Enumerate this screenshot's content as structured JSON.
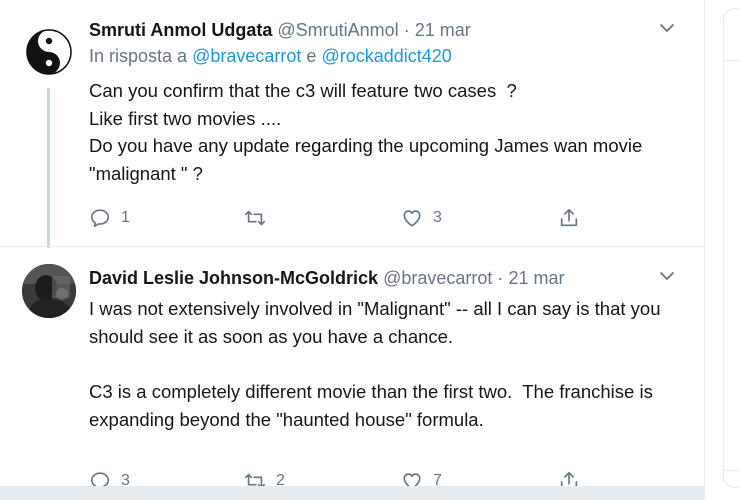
{
  "tweets": [
    {
      "display_name": "Smruti Anmol Udgata",
      "handle": "@SmrutiAnmol",
      "separator": "·",
      "date": "21 mar",
      "reply_prefix": "In risposta a",
      "reply_user1": "@bravecarrot",
      "reply_conj": "e",
      "reply_user2": "@rockaddict420",
      "text": "Can you confirm that the c3 will feature two cases  ?\nLike first two movies ....\nDo you have any update regarding the upcoming James wan movie \"malignant \" ?",
      "reply_count": "1",
      "retweet_count": "",
      "like_count": "3",
      "avatar_icon": "yin-yang-icon"
    },
    {
      "display_name": "David Leslie Johnson-McGoldrick",
      "handle": "@bravecarrot",
      "separator": "·",
      "date": "21 mar",
      "text": "I was not extensively involved in \"Malignant\" -- all I can say is that you should see it as soon as you have a chance.\n\nC3 is a completely different movie than the first two.  The franchise is expanding beyond the \"haunted house\" formula.",
      "reply_count": "3",
      "retweet_count": "2",
      "like_count": "7",
      "avatar_icon": "profile-photo"
    }
  ],
  "colors": {
    "text": "#14171a",
    "secondary": "#657786",
    "link": "#1b95e0",
    "border": "#e6ecf0",
    "thread_line": "#ccd6dd"
  }
}
